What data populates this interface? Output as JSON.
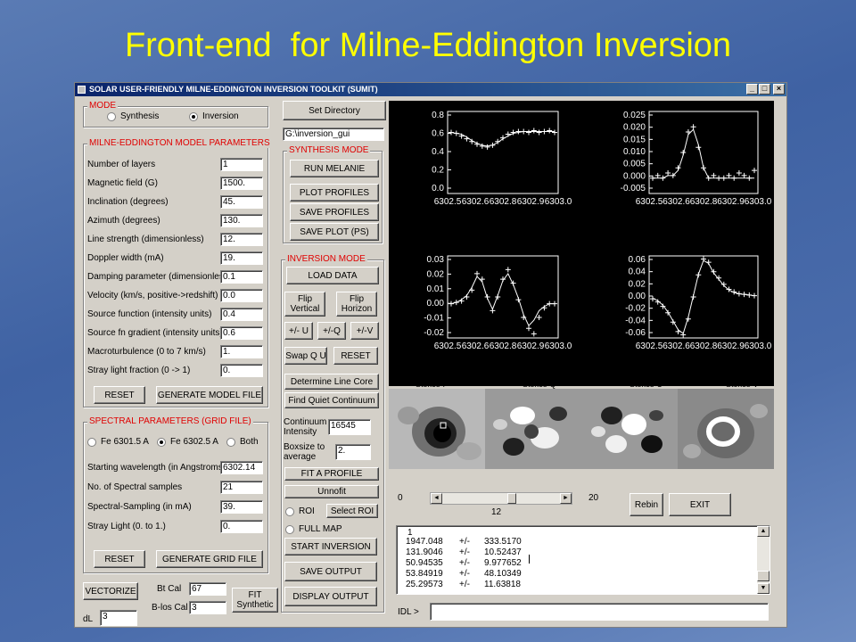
{
  "slide": {
    "title": "Front-end  for Milne-Eddington Inversion"
  },
  "window": {
    "title": "SOLAR USER-FRIENDLY MILNE-EDDINGTON INVERSION TOOLKIT  (SUMIT)",
    "controls": {
      "minimize": "_",
      "maximize": "□",
      "close": "×"
    }
  },
  "mode": {
    "title": "MODE",
    "synthesis": "Synthesis",
    "inversion": "Inversion",
    "selected": "Inversion"
  },
  "model": {
    "title": "MILNE-EDDINGTON MODEL PARAMETERS",
    "params": [
      {
        "label": "Number of layers",
        "value": "1"
      },
      {
        "label": "Magnetic field (G)",
        "value": "1500."
      },
      {
        "label": "Inclination (degrees)",
        "value": "45."
      },
      {
        "label": "Azimuth (degrees)",
        "value": "130."
      },
      {
        "label": "Line strength (dimensionless)",
        "value": "12."
      },
      {
        "label": "Doppler width (mA)",
        "value": "19."
      },
      {
        "label": "Damping parameter (dimensionless)",
        "value": "0.1"
      },
      {
        "label": "Velocity (km/s, positive->redshift)",
        "value": "0.0"
      },
      {
        "label": "Source function (intensity units)",
        "value": "0.4"
      },
      {
        "label": "Source fn gradient (intensity units)",
        "value": "0.6"
      },
      {
        "label": "Macroturbulence (0 to 7 km/s)",
        "value": "1."
      },
      {
        "label": "Stray light fraction (0 -> 1)",
        "value": "0."
      }
    ],
    "reset": "RESET",
    "generate": "GENERATE MODEL FILE"
  },
  "spectral": {
    "title": "SPECTRAL PARAMETERS (GRID FILE)",
    "line1": "Fe 6301.5 A",
    "line2": "Fe 6302.5 A",
    "both": "Both",
    "selected": "Fe 6302.5 A",
    "params": [
      {
        "label": "Starting wavelength (in Angstroms)",
        "value": "6302.14"
      },
      {
        "label": "No. of Spectral samples",
        "value": "21"
      },
      {
        "label": "Spectral-Sampling (in mA)",
        "value": "39."
      },
      {
        "label": "Stray Light (0. to 1.)",
        "value": "0."
      }
    ],
    "reset": "RESET",
    "generate": "GENERATE GRID FILE"
  },
  "bottom_left": {
    "vectorize": "VECTORIZE",
    "bt_cal_label": "Bt Cal",
    "bt_cal_value": "67",
    "blos_cal_label": "B-los Cal",
    "blos_cal_value": "3",
    "fit_synthetic": [
      "FIT",
      "Synthetic"
    ],
    "dl_label": "dL",
    "dl_value": "3"
  },
  "middle": {
    "set_directory": "Set Directory",
    "directory": "G:\\inversion_gui",
    "synthesis_title": "SYNTHESIS MODE",
    "run_melanie": "RUN MELANIE",
    "plot_profiles": "PLOT PROFILES",
    "save_profiles": "SAVE PROFILES",
    "save_plot": "SAVE PLOT (PS)",
    "inversion_title": "INVERSION MODE",
    "load_data": "LOAD DATA",
    "flip_vertical": [
      "Flip",
      "Vertical"
    ],
    "flip_horizon": [
      "Flip",
      "Horizon"
    ],
    "pm_u": "+/- U",
    "pm_q": "+/-Q",
    "pm_v": "+/-V",
    "swap_qu": "Swap Q U",
    "reset": "RESET",
    "determine_line_core": "Determine Line Core",
    "find_quiet": "Find Quiet Continuum",
    "continuum_label": [
      "Continuum",
      "Intensity"
    ],
    "continuum_value": "16545",
    "boxsize_label": [
      "Boxsize to",
      "average"
    ],
    "boxsize_value": "2.",
    "fit_profile": "FIT  A  PROFILE",
    "unnofit": "Unnofit",
    "roi": "ROI",
    "select_roi": "Select ROI",
    "full_map": "FULL MAP",
    "roi_selected": "",
    "start_inversion": "START INVERSION",
    "save_output": "SAVE OUTPUT",
    "display_output": "DISPLAY OUTPUT"
  },
  "images": {
    "labels": [
      "Stokes-I",
      "Stokes-Q",
      "Stokes-U",
      "Stokes-V"
    ]
  },
  "slider": {
    "min": "0",
    "max": "20",
    "value": "12",
    "rebin": "Rebin",
    "exit": "EXIT"
  },
  "console": {
    "header": "1",
    "rows": [
      {
        "value": "1947.048",
        "pm": "+/-",
        "err": "333.5170"
      },
      {
        "value": "131.9046",
        "pm": "+/-",
        "err": "10.52437"
      },
      {
        "value": "50.94535",
        "pm": "+/-",
        "err": "9.977652"
      },
      {
        "value": "53.84919",
        "pm": "+/-",
        "err": "48.10349"
      },
      {
        "value": "25.29573",
        "pm": "+/-",
        "err": "11.63818"
      }
    ],
    "idl_prompt": "IDL >"
  },
  "chart_data": [
    {
      "type": "line",
      "name": "stokes-i-plot",
      "yticks": [
        "0.8",
        "0.6",
        "0.4",
        "0.2",
        "0.0"
      ],
      "xticks": [
        "6302.5",
        "6302.6",
        "6302.8",
        "6302.9",
        "6303.0"
      ],
      "x": [
        6302.14,
        6302.18,
        6302.22,
        6302.26,
        6302.3,
        6302.34,
        6302.38,
        6302.42,
        6302.46,
        6302.5,
        6302.54,
        6302.58,
        6302.62,
        6302.66,
        6302.7,
        6302.74,
        6302.78,
        6302.82,
        6302.86,
        6302.9,
        6302.94
      ],
      "observed": [
        0.62,
        0.61,
        0.58,
        0.55,
        0.52,
        0.49,
        0.47,
        0.46,
        0.48,
        0.52,
        0.56,
        0.6,
        0.62,
        0.63,
        0.63,
        0.62,
        0.64,
        0.62,
        0.63,
        0.64,
        0.62
      ],
      "fit": [
        0.62,
        0.61,
        0.6,
        0.57,
        0.53,
        0.5,
        0.48,
        0.47,
        0.48,
        0.51,
        0.55,
        0.58,
        0.61,
        0.62,
        0.63,
        0.63,
        0.63,
        0.63,
        0.63,
        0.63,
        0.63
      ],
      "ylim": [
        -0.05,
        0.85
      ]
    },
    {
      "type": "line",
      "name": "stokes-q-plot",
      "yticks": [
        "0.025",
        "0.020",
        "0.015",
        "0.010",
        "0.005",
        "0.000",
        "-0.005"
      ],
      "xticks": [
        "6302.5",
        "6302.6",
        "6302.8",
        "6302.9",
        "6303.0"
      ],
      "x": [
        6302.14,
        6302.18,
        6302.22,
        6302.26,
        6302.3,
        6302.34,
        6302.38,
        6302.42,
        6302.46,
        6302.5,
        6302.54,
        6302.58,
        6302.62,
        6302.66,
        6302.7,
        6302.74,
        6302.78,
        6302.82,
        6302.86,
        6302.9,
        6302.94
      ],
      "observed": [
        0.0,
        0.001,
        0.0,
        0.002,
        0.001,
        0.004,
        0.01,
        0.018,
        0.02,
        0.012,
        0.004,
        0.0,
        0.001,
        0.0,
        0.0,
        0.001,
        0.0,
        0.002,
        0.001,
        0.0,
        0.003
      ],
      "fit": [
        0.0,
        0.0,
        0.0,
        0.001,
        0.001,
        0.003,
        0.009,
        0.017,
        0.019,
        0.013,
        0.004,
        0.0,
        0.0,
        0.0,
        0.0,
        0.0,
        0.0,
        0.0,
        0.0,
        0.0,
        0.0
      ],
      "ylim": [
        -0.006,
        0.026
      ]
    },
    {
      "type": "line",
      "name": "stokes-u-plot",
      "yticks": [
        "0.03",
        "0.02",
        "0.01",
        "0.00",
        "-0.01",
        "-0.02"
      ],
      "xticks": [
        "6302.5",
        "6302.6",
        "6302.8",
        "6302.9",
        "6303.0"
      ],
      "x": [
        6302.14,
        6302.18,
        6302.22,
        6302.26,
        6302.3,
        6302.34,
        6302.38,
        6302.42,
        6302.46,
        6302.5,
        6302.54,
        6302.58,
        6302.62,
        6302.66,
        6302.7,
        6302.74,
        6302.78,
        6302.82,
        6302.86,
        6302.9,
        6302.94
      ],
      "observed": [
        0.0,
        0.001,
        0.002,
        0.005,
        0.01,
        0.022,
        0.018,
        0.005,
        -0.005,
        0.005,
        0.018,
        0.025,
        0.015,
        0.003,
        -0.01,
        -0.018,
        -0.022,
        -0.01,
        -0.003,
        0.0,
        0.0
      ],
      "fit": [
        0.0,
        0.001,
        0.003,
        0.006,
        0.012,
        0.02,
        0.016,
        0.004,
        -0.004,
        0.006,
        0.017,
        0.022,
        0.014,
        0.004,
        -0.008,
        -0.016,
        -0.012,
        -0.005,
        -0.002,
        0.0,
        0.0
      ],
      "ylim": [
        -0.025,
        0.035
      ]
    },
    {
      "type": "line",
      "name": "stokes-v-plot",
      "yticks": [
        "0.06",
        "0.04",
        "0.02",
        "0.00",
        "-0.02",
        "-0.04",
        "-0.06"
      ],
      "xticks": [
        "6302.5",
        "6302.6",
        "6302.8",
        "6302.9",
        "6303.0"
      ],
      "x": [
        6302.14,
        6302.18,
        6302.22,
        6302.26,
        6302.3,
        6302.34,
        6302.38,
        6302.42,
        6302.46,
        6302.5,
        6302.54,
        6302.58,
        6302.62,
        6302.66,
        6302.7,
        6302.74,
        6302.78,
        6302.82,
        6302.86,
        6302.9,
        6302.94
      ],
      "observed": [
        -0.003,
        -0.008,
        -0.015,
        -0.025,
        -0.04,
        -0.055,
        -0.06,
        -0.035,
        0.0,
        0.035,
        0.06,
        0.055,
        0.04,
        0.03,
        0.02,
        0.012,
        0.008,
        0.005,
        0.004,
        0.003,
        0.002
      ],
      "fit": [
        -0.002,
        -0.006,
        -0.013,
        -0.024,
        -0.038,
        -0.052,
        -0.058,
        -0.032,
        0.002,
        0.036,
        0.058,
        0.053,
        0.038,
        0.028,
        0.018,
        0.011,
        0.007,
        0.005,
        0.004,
        0.003,
        0.002
      ],
      "ylim": [
        -0.065,
        0.065
      ]
    }
  ]
}
